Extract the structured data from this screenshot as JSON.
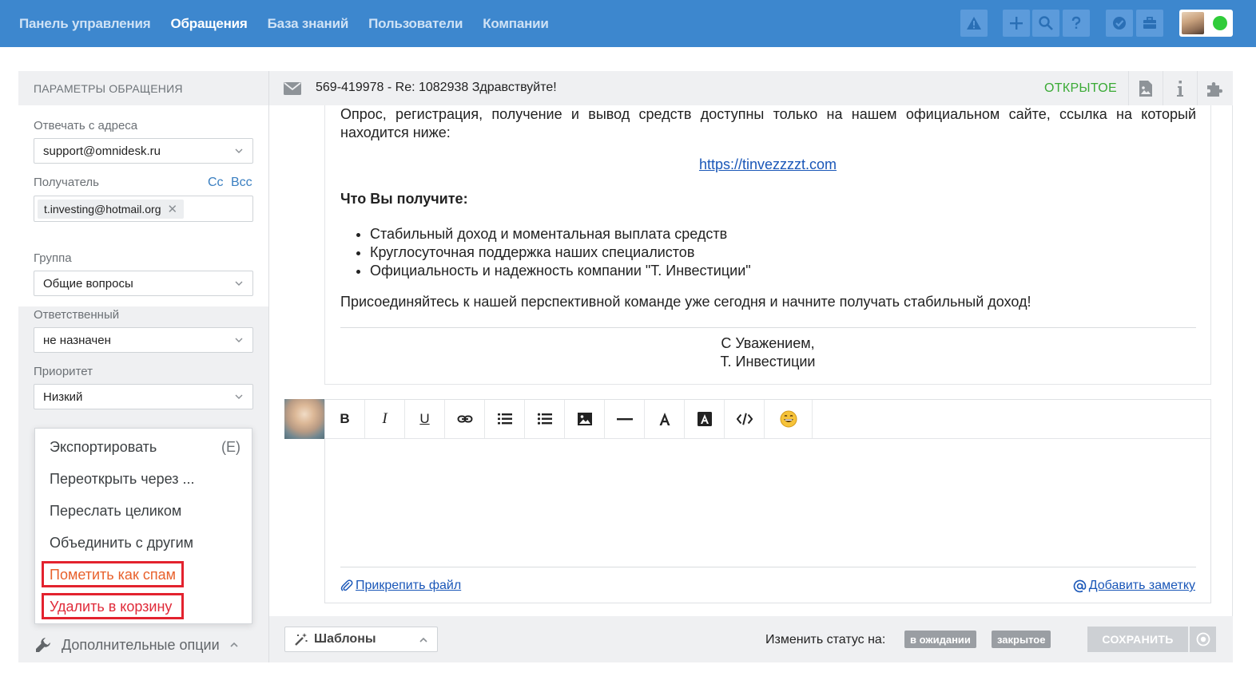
{
  "nav": {
    "items": [
      "Панель управления",
      "Обращения",
      "База знаний",
      "Пользователи",
      "Компании"
    ]
  },
  "sidebar": {
    "title": "ПАРАМЕТРЫ ОБРАЩЕНИЯ",
    "reply_from_label": "Отвечать с адреса",
    "reply_from_value": "support@omnidesk.ru",
    "recipient_label": "Получатель",
    "cc": "Cc",
    "bcc": "Bcc",
    "recipient_chip": "t.investing@hotmail.org",
    "group_label": "Группа",
    "group_value": "Общие вопросы",
    "assignee_label": "Ответственный",
    "assignee_value": "не назначен",
    "priority_label": "Приоритет",
    "priority_value": "Низкий",
    "menu": {
      "export": "Экспортировать",
      "export_shortcut": "(E)",
      "reopen": "Переоткрыть через ...",
      "forward": "Переслать целиком",
      "merge": "Объединить с другим",
      "spam": "Пометить как спам",
      "trash": "Удалить в корзину"
    },
    "more_options": "Дополнительные опции"
  },
  "ticket": {
    "subject": "569-419978 - Re: 1082938 Здравствуйте!",
    "status": "ОТКРЫТОЕ"
  },
  "message": {
    "para1": "Опрос, регистрация, получение и вывод средств доступны только на нашем официальном сайте, ссылка на который находится ниже:",
    "link": "https://tinvezzzzt.com",
    "heading": "Что Вы получите:",
    "bullets": [
      "Стабильный доход и моментальная выплата средств",
      "Круглосуточная поддержка наших специалистов",
      "Официальность и надежность компании \"Т. Инвестиции\""
    ],
    "para2": "Присоединяйтесь к нашей перспективной команде уже сегодня и начните получать стабильный доход!",
    "sig1": "С Уважением,",
    "sig2": "Т. Инвестиции"
  },
  "editor": {
    "bold": "B",
    "italic": "I",
    "underline": "U",
    "attach": "Прикрепить файл",
    "add_note": "Добавить заметку"
  },
  "footer": {
    "templates": "Шаблоны",
    "change_status": "Изменить статус на:",
    "status_waiting": "в ожидании",
    "status_closed": "закрытое",
    "save": "СОХРАНИТЬ"
  }
}
